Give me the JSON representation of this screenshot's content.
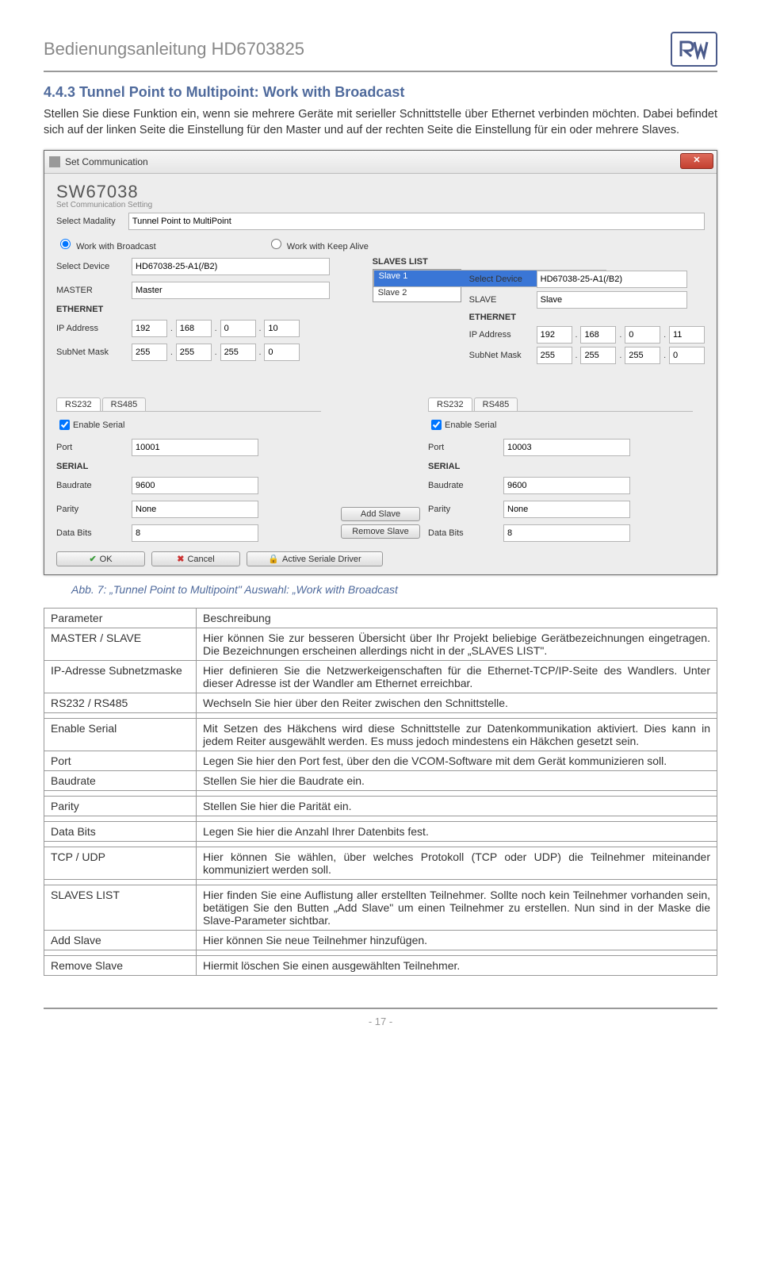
{
  "header": {
    "title": "Bedienungsanleitung HD6703825"
  },
  "section": {
    "title": "4.4.3  Tunnel Point to Multipoint: Work with Broadcast"
  },
  "intro": {
    "p1": "Stellen Sie diese Funktion ein, wenn sie mehrere Geräte mit serieller Schnittstelle über Ethernet verbinden möchten. Dabei befindet sich auf der linken Seite die Einstellung für den Master und auf der rechten Seite die Einstellung für ein oder mehrere Slaves."
  },
  "win": {
    "title": "Set Communication",
    "brand": "SW67038",
    "brand_sub": "Set Communication Setting",
    "select_modality_label": "Select Madality",
    "select_modality_value": "Tunnel Point to MultiPoint",
    "radio_broadcast": "Work with Broadcast",
    "radio_keepalive": "Work with Keep Alive",
    "select_device_label": "Select Device",
    "device_value": "HD67038-25-A1(/B2)",
    "master_label": "MASTER",
    "master_value": "Master",
    "eth_head": "ETHERNET",
    "ip_label": "IP Address",
    "subnet_label": "SubNet Mask",
    "master_ip": [
      "192",
      "168",
      "0",
      "10"
    ],
    "master_mask": [
      "255",
      "255",
      "255",
      "0"
    ],
    "slaves_list_label": "SLAVES LIST",
    "slave_items": [
      "Slave 1",
      "Slave 2"
    ],
    "slave_label": "SLAVE",
    "slave_value": "Slave",
    "slave_ip": [
      "192",
      "168",
      "0",
      "11"
    ],
    "slave_mask": [
      "255",
      "255",
      "255",
      "0"
    ],
    "tab_rs232": "RS232",
    "tab_rs485": "RS485",
    "enable_serial": "Enable Serial",
    "port_label": "Port",
    "port_master": "10001",
    "port_slave": "10003",
    "serial_head": "SERIAL",
    "baud_label": "Baudrate",
    "baud_value": "9600",
    "parity_label": "Parity",
    "parity_value": "None",
    "databits_label": "Data Bits",
    "databits_value": "8",
    "add_slave": "Add Slave",
    "remove_slave": "Remove Slave",
    "ok": "OK",
    "cancel": "Cancel",
    "active_driver": "Active Seriale Driver"
  },
  "caption": "Abb. 7: „Tunnel Point to Multipoint\" Auswahl: „Work with Broadcast",
  "table": {
    "head": [
      "Parameter",
      "Beschreibung"
    ],
    "rows": [
      [
        "MASTER / SLAVE",
        "Hier können Sie zur besseren Übersicht über Ihr Projekt beliebige Gerätbezeichnungen eingetragen. Die Bezeichnungen erscheinen allerdings nicht in der „SLAVES LIST\"."
      ],
      [
        "IP-Adresse Subnetzmaske",
        "Hier definieren Sie die Netzwerkeigenschaften für die Ethernet-TCP/IP-Seite des Wandlers. Unter dieser Adresse ist der Wandler am Ethernet erreichbar."
      ],
      [
        "RS232 / RS485",
        "Wechseln Sie hier über den Reiter zwischen den Schnittstelle."
      ],
      [
        "Enable Serial",
        "Mit Setzen des Häkchens wird diese Schnittstelle zur Datenkommunikation aktiviert. Dies kann in jedem Reiter ausgewählt werden. Es muss jedoch mindestens ein Häkchen gesetzt sein."
      ],
      [
        "Port",
        "Legen Sie hier den Port fest, über den die VCOM-Software mit dem Gerät kommunizieren soll."
      ],
      [
        "Baudrate",
        "Stellen Sie hier die Baudrate ein."
      ],
      [
        "Parity",
        "Stellen Sie hier die Parität ein."
      ],
      [
        "Data Bits",
        "Legen Sie hier die Anzahl Ihrer Datenbits fest."
      ],
      [
        "TCP / UDP",
        "Hier können Sie wählen, über welches Protokoll (TCP oder UDP) die Teilnehmer miteinander kommuniziert werden soll."
      ],
      [
        "SLAVES LIST",
        "Hier finden Sie eine Auflistung aller erstellten Teilnehmer. Sollte noch kein Teilnehmer vorhanden sein, betätigen Sie den Butten „Add Slave\" um einen Teilnehmer zu erstellen. Nun sind in der Maske die Slave-Parameter sichtbar."
      ],
      [
        "Add Slave",
        "Hier können Sie neue Teilnehmer hinzufügen."
      ],
      [
        "Remove Slave",
        "Hiermit löschen Sie einen ausgewählten Teilnehmer."
      ]
    ]
  },
  "footer": {
    "page": "- 17 -"
  }
}
